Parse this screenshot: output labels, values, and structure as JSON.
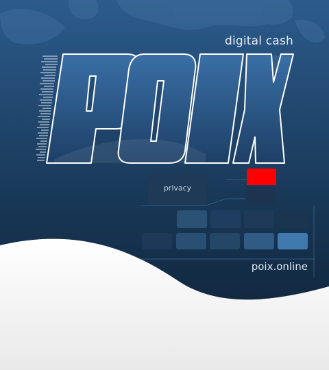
{
  "brand": {
    "logo_text": "POIX",
    "tagline": "digital cash",
    "website": "poix.online",
    "tile_label": "privacy"
  },
  "colors": {
    "background_top": "#2c5b8c",
    "background_bottom": "#0d1e31",
    "accent": "#ff0000",
    "wave": "#f2f2f2"
  }
}
